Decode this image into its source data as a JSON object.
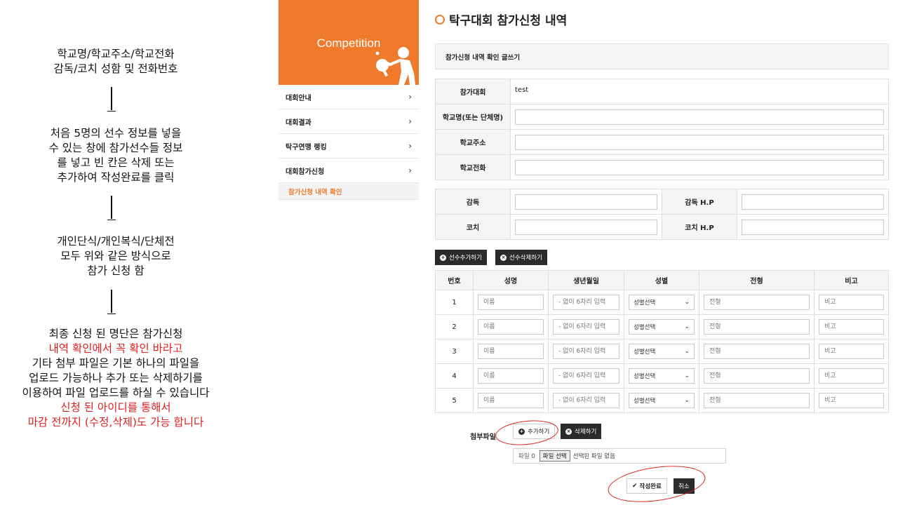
{
  "guide": {
    "step1": [
      "학교명/학교주소/학교전화",
      "감독/코치 성함 및 전화번호"
    ],
    "step2": [
      "처음 5명의 선수 정보를 넣을",
      "수 있는 창에 참가선수들 정보",
      "를 넣고 빈 칸은 삭제  또는",
      "추가하여 작성완료를 클릭"
    ],
    "step3": [
      "개인단식/개인복식/단체전",
      "모두 위와 같은 방식으로",
      "참가 신청 함"
    ],
    "step4": {
      "line1": "최종 신청 된 명단은 참가신청",
      "line2": "내역 확인에서 꼭 확인 바라고",
      "line3": "기타 첨부 파일은 기본 하나의 파일을",
      "line4": "업로드 가능하나 추가 또는 삭제하기를",
      "line5": "이용하여 파일 업로드를 하실 수 있습니다",
      "line6": "신청 된 아이디를 통해서",
      "line7": "마감 전까지 (수정,삭제)도 가능 합니다"
    },
    "accent_color": "#e02020"
  },
  "sidebar": {
    "banner_title": "Competition",
    "banner_color": "#f07a2c",
    "items": [
      {
        "label": "대회안내"
      },
      {
        "label": "대회결과"
      },
      {
        "label": "탁구연맹 랭킹"
      },
      {
        "label": "대회참가신청"
      }
    ],
    "active_sub": "참가신청 내역 확인"
  },
  "main": {
    "title": "탁구대회 참가신청 내역",
    "notice": "참가신청 내역 확인 글쓰기",
    "school": {
      "competition_label": "참가대회",
      "competition_value": "test",
      "name_label": "학교명(또는 단체명)",
      "address_label": "학교주소",
      "phone_label": "학교전화"
    },
    "staff": {
      "coach_label": "감독",
      "coach_phone_label": "감독 H.P",
      "assistant_label": "코치",
      "assistant_phone_label": "코치 H.P"
    },
    "player_buttons": {
      "add": "선수추가하기",
      "remove": "선수삭제하기"
    },
    "players_table": {
      "headers": [
        "번호",
        "성명",
        "생년월일",
        "성별",
        "전형",
        "비고"
      ],
      "rows": [
        {
          "no": "1",
          "name_ph": "이름",
          "birth_ph": "- 없이 6자리 입력",
          "gender": "성별선택",
          "type_ph": "전형",
          "note_ph": "비고"
        },
        {
          "no": "2",
          "name_ph": "이름",
          "birth_ph": "- 없이 6자리 입력",
          "gender": "성별선택",
          "type_ph": "전형",
          "note_ph": "비고"
        },
        {
          "no": "3",
          "name_ph": "이름",
          "birth_ph": "- 없이 6자리 입력",
          "gender": "성별선택",
          "type_ph": "전형",
          "note_ph": "비고"
        },
        {
          "no": "4",
          "name_ph": "이름",
          "birth_ph": "- 없이 6자리 입력",
          "gender": "성별선택",
          "type_ph": "전형",
          "note_ph": "비고"
        },
        {
          "no": "5",
          "name_ph": "이름",
          "birth_ph": "- 없이 6자리 입력",
          "gender": "성별선택",
          "type_ph": "전형",
          "note_ph": "비고"
        }
      ]
    },
    "attachment": {
      "label": "첨부파일",
      "add": "추가하기",
      "remove": "삭제하기",
      "file_label": "파일 0",
      "choose": "파일 선택",
      "none": "선택된 파일 없음"
    },
    "submit": "작성완료",
    "cancel": "취소",
    "highlight_color": "#d9201a"
  }
}
